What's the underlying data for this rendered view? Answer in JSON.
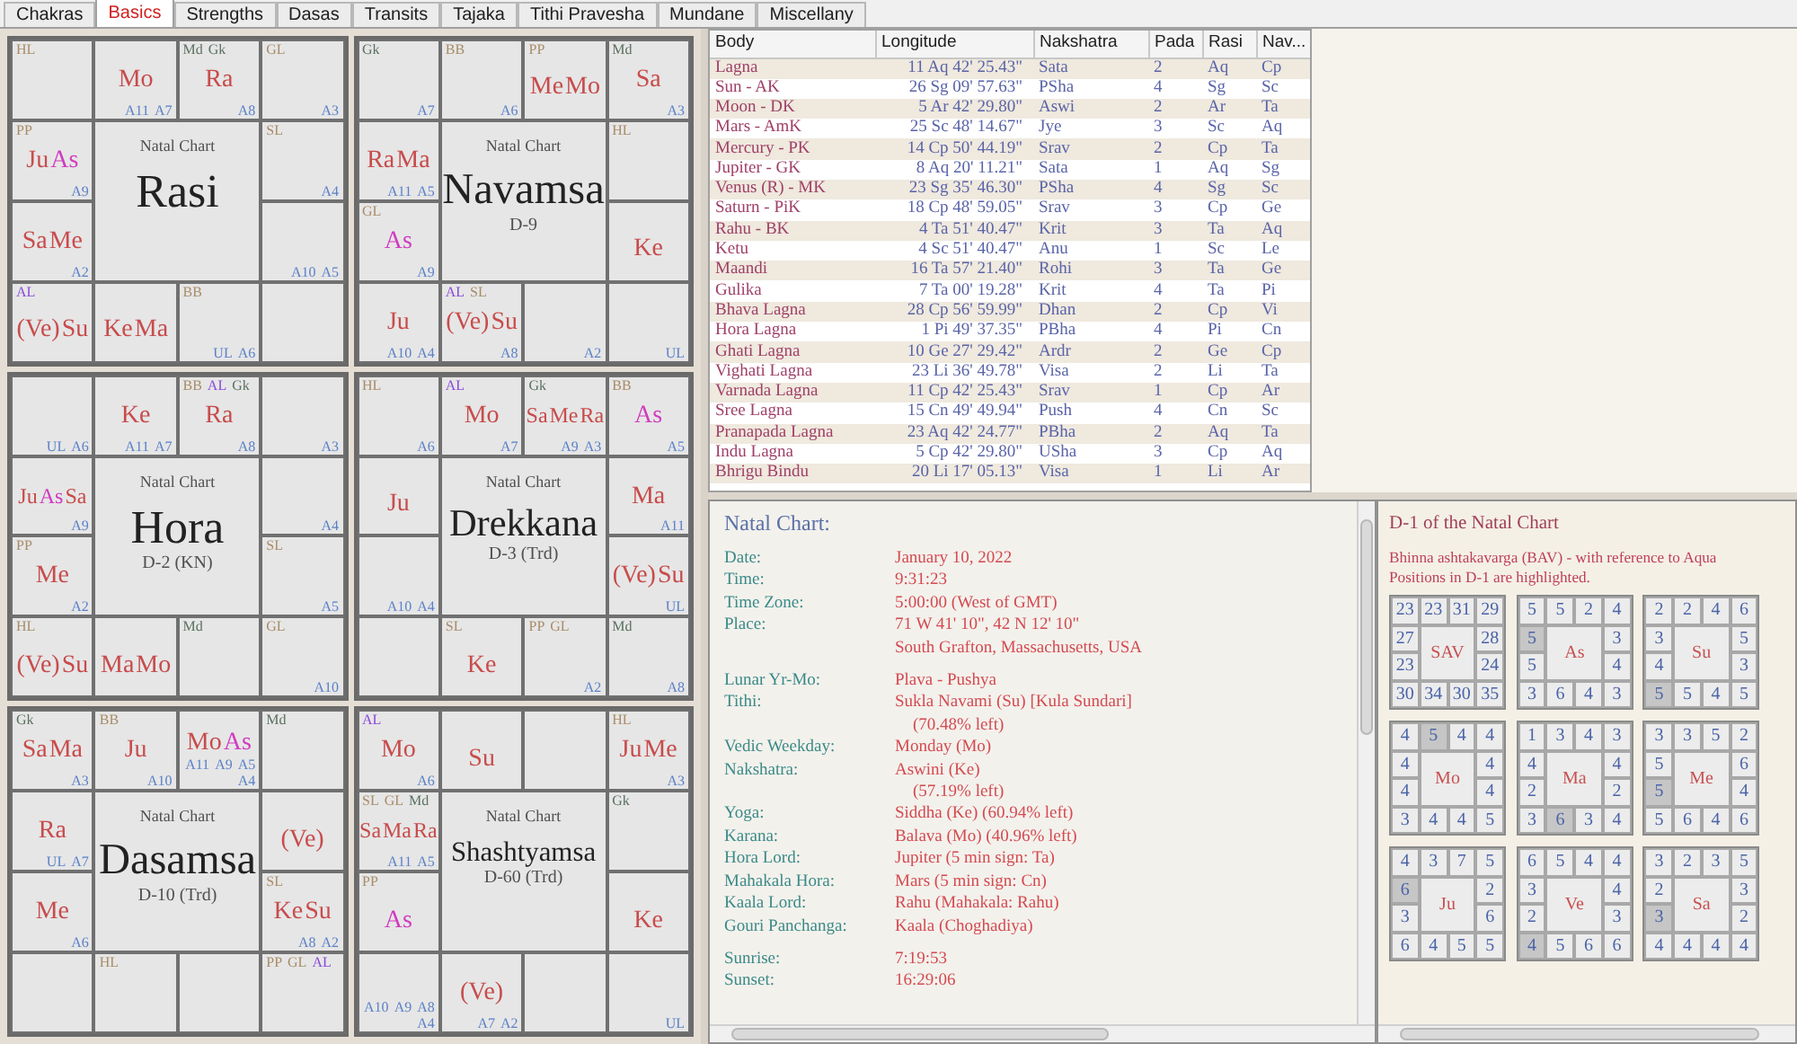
{
  "tabs": [
    {
      "label": "Chakras",
      "selected": false
    },
    {
      "label": "Basics",
      "selected": true
    },
    {
      "label": "Strengths",
      "selected": false
    },
    {
      "label": "Dasas",
      "selected": false
    },
    {
      "label": "Transits",
      "selected": false
    },
    {
      "label": "Tajaka",
      "selected": false
    },
    {
      "label": "Tithi Pravesha",
      "selected": false
    },
    {
      "label": "Mundane",
      "selected": false
    },
    {
      "label": "Miscellany",
      "selected": false
    }
  ],
  "charts": [
    {
      "caption": "Natal Chart",
      "title": "Rasi",
      "cells": [
        {
          "markers": [
            {
              "text": "HL",
              "kind": "special"
            }
          ]
        },
        {
          "planets": [
            {
              "text": "Mo",
              "kind": "planet"
            }
          ],
          "arudhas": [
            "A11",
            "A7"
          ]
        },
        {
          "markers": [
            {
              "text": "Md",
              "kind": "upagraha"
            },
            {
              "text": "Gk",
              "kind": "upagraha"
            }
          ],
          "planets": [
            {
              "text": "Ra",
              "kind": "planet"
            }
          ],
          "arudhas": [
            "A8"
          ]
        },
        {
          "markers": [
            {
              "text": "GL",
              "kind": "special"
            }
          ],
          "arudhas": [
            "A3"
          ]
        },
        {
          "markers": [
            {
              "text": "PP",
              "kind": "special"
            }
          ],
          "planets": [
            {
              "text": "Ju",
              "kind": "planet"
            },
            {
              "text": "As",
              "kind": "lagna"
            }
          ],
          "arudhas": [
            "A9"
          ]
        },
        {
          "markers": [
            {
              "text": "SL",
              "kind": "special"
            }
          ],
          "arudhas": [
            "A4"
          ]
        },
        {
          "planets": [
            {
              "text": "Sa",
              "kind": "planet"
            },
            {
              "text": "Me",
              "kind": "planet"
            }
          ],
          "arudhas": [
            "A2"
          ]
        },
        {
          "arudhas": [
            "A10",
            "A5"
          ]
        },
        {
          "markers": [
            {
              "text": "AL",
              "kind": "arudha_lagna"
            }
          ],
          "planets": [
            {
              "text": "(Ve)",
              "kind": "planet"
            },
            {
              "text": "Su",
              "kind": "planet"
            }
          ]
        },
        {
          "planets": [
            {
              "text": "Ke",
              "kind": "planet"
            },
            {
              "text": "Ma",
              "kind": "planet"
            }
          ]
        },
        {
          "markers": [
            {
              "text": "BB",
              "kind": "special"
            }
          ],
          "arudhas": [
            "UL",
            "A6"
          ]
        },
        {}
      ]
    },
    {
      "caption": "Natal Chart",
      "title": "Navamsa",
      "subtitle": "D-9",
      "cells": [
        {
          "markers": [
            {
              "text": "Gk",
              "kind": "upagraha"
            }
          ],
          "arudhas": [
            "A7"
          ]
        },
        {
          "markers": [
            {
              "text": "BB",
              "kind": "special"
            }
          ],
          "arudhas": [
            "A6"
          ]
        },
        {
          "markers": [
            {
              "text": "PP",
              "kind": "special"
            }
          ],
          "planets": [
            {
              "text": "Me",
              "kind": "planet"
            },
            {
              "text": "Mo",
              "kind": "planet"
            }
          ]
        },
        {
          "markers": [
            {
              "text": "Md",
              "kind": "upagraha"
            }
          ],
          "planets": [
            {
              "text": "Sa",
              "kind": "planet"
            }
          ],
          "arudhas": [
            "A3"
          ]
        },
        {
          "planets": [
            {
              "text": "Ra",
              "kind": "planet"
            },
            {
              "text": "Ma",
              "kind": "planet"
            }
          ],
          "arudhas": [
            "A11",
            "A5"
          ]
        },
        {
          "markers": [
            {
              "text": "HL",
              "kind": "special"
            }
          ]
        },
        {
          "markers": [
            {
              "text": "GL",
              "kind": "special"
            }
          ],
          "planets": [
            {
              "text": "As",
              "kind": "lagna"
            }
          ],
          "arudhas": [
            "A9"
          ]
        },
        {
          "planets": [
            {
              "text": "Ke",
              "kind": "planet"
            }
          ]
        },
        {
          "planets": [
            {
              "text": "Ju",
              "kind": "planet"
            }
          ],
          "arudhas": [
            "A10",
            "A4"
          ]
        },
        {
          "markers": [
            {
              "text": "AL",
              "kind": "arudha_lagna"
            },
            {
              "text": "SL",
              "kind": "special"
            }
          ],
          "planets": [
            {
              "text": "(Ve)",
              "kind": "planet"
            },
            {
              "text": "Su",
              "kind": "planet"
            }
          ],
          "arudhas": [
            "A8"
          ]
        },
        {
          "arudhas": [
            "A2"
          ]
        },
        {
          "arudhas": [
            "UL"
          ]
        }
      ]
    },
    {
      "caption": "Natal Chart",
      "title": "Hora",
      "subtitle": "D-2 (KN)",
      "cells": [
        {
          "arudhas": [
            "UL",
            "A6"
          ]
        },
        {
          "planets": [
            {
              "text": "Ke",
              "kind": "planet"
            }
          ],
          "arudhas": [
            "A11",
            "A7"
          ]
        },
        {
          "markers": [
            {
              "text": "BB",
              "kind": "special"
            },
            {
              "text": "AL",
              "kind": "arudha_lagna"
            },
            {
              "text": "Gk",
              "kind": "upagraha"
            }
          ],
          "planets": [
            {
              "text": "Ra",
              "kind": "planet"
            }
          ],
          "arudhas": [
            "A8"
          ]
        },
        {
          "arudhas": [
            "A3"
          ]
        },
        {
          "planets": [
            {
              "text": "Ju",
              "kind": "planet"
            },
            {
              "text": "As",
              "kind": "lagna"
            },
            {
              "text": "Sa",
              "kind": "planet"
            }
          ],
          "arudhas": [
            "A9"
          ]
        },
        {
          "arudhas": [
            "A4"
          ]
        },
        {
          "markers": [
            {
              "text": "PP",
              "kind": "special"
            }
          ],
          "planets": [
            {
              "text": "Me",
              "kind": "planet"
            }
          ],
          "arudhas": [
            "A2"
          ]
        },
        {
          "markers": [
            {
              "text": "SL",
              "kind": "special"
            }
          ],
          "arudhas": [
            "A5"
          ]
        },
        {
          "markers": [
            {
              "text": "HL",
              "kind": "special"
            }
          ],
          "planets": [
            {
              "text": "(Ve)",
              "kind": "planet"
            },
            {
              "text": "Su",
              "kind": "planet"
            }
          ]
        },
        {
          "planets": [
            {
              "text": "Ma",
              "kind": "planet"
            },
            {
              "text": "Mo",
              "kind": "planet"
            }
          ]
        },
        {
          "markers": [
            {
              "text": "Md",
              "kind": "upagraha"
            }
          ]
        },
        {
          "markers": [
            {
              "text": "GL",
              "kind": "special"
            }
          ],
          "arudhas": [
            "A10"
          ]
        }
      ]
    },
    {
      "caption": "Natal Chart",
      "title": "Drekkana",
      "subtitle": "D-3 (Trd)",
      "cells": [
        {
          "markers": [
            {
              "text": "HL",
              "kind": "special"
            }
          ],
          "arudhas": [
            "A6"
          ]
        },
        {
          "markers": [
            {
              "text": "AL",
              "kind": "arudha_lagna"
            }
          ],
          "planets": [
            {
              "text": "Mo",
              "kind": "planet"
            }
          ],
          "arudhas": [
            "A7"
          ]
        },
        {
          "markers": [
            {
              "text": "Gk",
              "kind": "upagraha"
            }
          ],
          "planets": [
            {
              "text": "Sa",
              "kind": "planet"
            },
            {
              "text": "Me",
              "kind": "planet"
            },
            {
              "text": "Ra",
              "kind": "planet"
            }
          ],
          "arudhas": [
            "A9",
            "A3"
          ]
        },
        {
          "markers": [
            {
              "text": "BB",
              "kind": "special"
            }
          ],
          "planets": [
            {
              "text": "As",
              "kind": "lagna"
            }
          ],
          "arudhas": [
            "A5"
          ]
        },
        {
          "planets": [
            {
              "text": "Ju",
              "kind": "planet"
            }
          ]
        },
        {
          "planets": [
            {
              "text": "Ma",
              "kind": "planet"
            }
          ],
          "arudhas": [
            "A11"
          ]
        },
        {
          "arudhas": [
            "A10",
            "A4"
          ]
        },
        {
          "planets": [
            {
              "text": "(Ve)",
              "kind": "planet"
            },
            {
              "text": "Su",
              "kind": "planet"
            }
          ],
          "arudhas": [
            "UL"
          ]
        },
        {},
        {
          "markers": [
            {
              "text": "SL",
              "kind": "special"
            }
          ],
          "planets": [
            {
              "text": "Ke",
              "kind": "planet"
            }
          ]
        },
        {
          "markers": [
            {
              "text": "PP",
              "kind": "special"
            },
            {
              "text": "GL",
              "kind": "special"
            }
          ],
          "arudhas": [
            "A2"
          ]
        },
        {
          "markers": [
            {
              "text": "Md",
              "kind": "upagraha"
            }
          ],
          "arudhas": [
            "A8"
          ]
        }
      ]
    },
    {
      "caption": "Natal Chart",
      "title": "Dasamsa",
      "subtitle": "D-10 (Trd)",
      "cells": [
        {
          "markers": [
            {
              "text": "Gk",
              "kind": "upagraha"
            }
          ],
          "planets": [
            {
              "text": "Sa",
              "kind": "planet"
            },
            {
              "text": "Ma",
              "kind": "planet"
            }
          ],
          "arudhas": [
            "A3"
          ]
        },
        {
          "markers": [
            {
              "text": "BB",
              "kind": "special"
            }
          ],
          "planets": [
            {
              "text": "Ju",
              "kind": "planet"
            }
          ],
          "arudhas": [
            "A10"
          ]
        },
        {
          "planets": [
            {
              "text": "Mo",
              "kind": "planet"
            },
            {
              "text": "As",
              "kind": "lagna"
            }
          ],
          "arudhas": [
            "A11",
            "A9",
            "A5",
            "A4"
          ]
        },
        {
          "markers": [
            {
              "text": "Md",
              "kind": "upagraha"
            }
          ]
        },
        {
          "planets": [
            {
              "text": "Ra",
              "kind": "planet"
            }
          ],
          "arudhas": [
            "UL",
            "A7"
          ]
        },
        {
          "planets": [
            {
              "text": "(Ve)",
              "kind": "planet"
            }
          ]
        },
        {
          "planets": [
            {
              "text": "Me",
              "kind": "planet"
            }
          ],
          "arudhas": [
            "A6"
          ]
        },
        {
          "markers": [
            {
              "text": "SL",
              "kind": "special"
            }
          ],
          "planets": [
            {
              "text": "Ke",
              "kind": "planet"
            },
            {
              "text": "Su",
              "kind": "planet"
            }
          ],
          "arudhas": [
            "A8",
            "A2"
          ]
        },
        {},
        {
          "markers": [
            {
              "text": "HL",
              "kind": "special"
            }
          ]
        },
        {},
        {
          "markers": [
            {
              "text": "PP",
              "kind": "special"
            },
            {
              "text": "GL",
              "kind": "special"
            },
            {
              "text": "AL",
              "kind": "arudha_lagna"
            }
          ]
        }
      ]
    },
    {
      "caption": "Natal Chart",
      "title": "Shashtyamsa",
      "subtitle": "D-60 (Trd)",
      "cells": [
        {
          "markers": [
            {
              "text": "AL",
              "kind": "arudha_lagna"
            }
          ],
          "planets": [
            {
              "text": "Mo",
              "kind": "planet"
            }
          ],
          "arudhas": [
            "A6"
          ]
        },
        {
          "planets": [
            {
              "text": "Su",
              "kind": "planet"
            }
          ]
        },
        {},
        {
          "markers": [
            {
              "text": "HL",
              "kind": "special"
            }
          ],
          "planets": [
            {
              "text": "Ju",
              "kind": "planet"
            },
            {
              "text": "Me",
              "kind": "planet"
            }
          ],
          "arudhas": [
            "A3"
          ]
        },
        {
          "markers": [
            {
              "text": "SL",
              "kind": "special"
            },
            {
              "text": "GL",
              "kind": "special"
            },
            {
              "text": "Md",
              "kind": "upagraha"
            }
          ],
          "planets": [
            {
              "text": "Sa",
              "kind": "planet"
            },
            {
              "text": "Ma",
              "kind": "planet"
            },
            {
              "text": "Ra",
              "kind": "planet"
            }
          ],
          "arudhas": [
            "A11",
            "A5"
          ]
        },
        {
          "markers": [
            {
              "text": "Gk",
              "kind": "upagraha"
            }
          ]
        },
        {
          "markers": [
            {
              "text": "PP",
              "kind": "special"
            }
          ],
          "planets": [
            {
              "text": "As",
              "kind": "lagna"
            }
          ]
        },
        {
          "planets": [
            {
              "text": "Ke",
              "kind": "planet"
            }
          ]
        },
        {
          "arudhas": [
            "A10",
            "A9",
            "A8",
            "A4"
          ]
        },
        {
          "planets": [
            {
              "text": "(Ve)",
              "kind": "planet"
            }
          ],
          "arudhas": [
            "A7",
            "A2"
          ]
        },
        {},
        {
          "arudhas": [
            "UL"
          ]
        }
      ]
    }
  ],
  "table": {
    "columns": [
      "Body",
      "Longitude",
      "Nakshatra",
      "Pada",
      "Rasi",
      "Nav..."
    ],
    "rows": [
      [
        "Lagna",
        "11 Aq 42' 25.43\"",
        "Sata",
        "2",
        "Aq",
        "Cp"
      ],
      [
        "Sun - AK",
        "26 Sg 09' 57.63\"",
        "PSha",
        "4",
        "Sg",
        "Sc"
      ],
      [
        "Moon - DK",
        "5 Ar 42' 29.80\"",
        "Aswi",
        "2",
        "Ar",
        "Ta"
      ],
      [
        "Mars - AmK",
        "25 Sc 48' 14.67\"",
        "Jye",
        "3",
        "Sc",
        "Aq"
      ],
      [
        "Mercury - PK",
        "14 Cp 50' 44.19\"",
        "Srav",
        "2",
        "Cp",
        "Ta"
      ],
      [
        "Jupiter - GK",
        "8 Aq 20' 11.21\"",
        "Sata",
        "1",
        "Aq",
        "Sg"
      ],
      [
        "Venus (R) - MK",
        "23 Sg 35' 46.30\"",
        "PSha",
        "4",
        "Sg",
        "Sc"
      ],
      [
        "Saturn - PiK",
        "18 Cp 48' 59.05\"",
        "Srav",
        "3",
        "Cp",
        "Ge"
      ],
      [
        "Rahu - BK",
        "4 Ta 51' 40.47\"",
        "Krit",
        "3",
        "Ta",
        "Aq"
      ],
      [
        "Ketu",
        "4 Sc 51' 40.47\"",
        "Anu",
        "1",
        "Sc",
        "Le"
      ],
      [
        "Maandi",
        "16 Ta 57' 21.40\"",
        "Rohi",
        "3",
        "Ta",
        "Ge"
      ],
      [
        "Gulika",
        "7 Ta 00' 19.28\"",
        "Krit",
        "4",
        "Ta",
        "Pi"
      ],
      [
        "Bhava Lagna",
        "28 Cp 56' 59.99\"",
        "Dhan",
        "2",
        "Cp",
        "Vi"
      ],
      [
        "Hora Lagna",
        "1 Pi 49' 37.35\"",
        "PBha",
        "4",
        "Pi",
        "Cn"
      ],
      [
        "Ghati Lagna",
        "10 Ge 27' 29.42\"",
        "Ardr",
        "2",
        "Ge",
        "Cp"
      ],
      [
        "Vighati Lagna",
        "23 Li 36' 49.78\"",
        "Visa",
        "2",
        "Li",
        "Ta"
      ],
      [
        "Varnada Lagna",
        "11 Cp 42' 25.43\"",
        "Srav",
        "1",
        "Cp",
        "Ar"
      ],
      [
        "Sree Lagna",
        "15 Cn 49' 49.94\"",
        "Push",
        "4",
        "Cn",
        "Sc"
      ],
      [
        "Pranapada Lagna",
        "23 Aq 42' 24.77\"",
        "PBha",
        "2",
        "Aq",
        "Ta"
      ],
      [
        "Indu Lagna",
        "5 Cp 42' 29.80\"",
        "USha",
        "3",
        "Cp",
        "Aq"
      ],
      [
        "Bhrigu Bindu",
        "20 Li 17' 05.13\"",
        "Visa",
        "1",
        "Li",
        "Ar"
      ]
    ]
  },
  "natal_info": {
    "heading": "Natal Chart:",
    "groups": [
      [
        {
          "kind": "field",
          "label": "Date:",
          "value": "January 10, 2022"
        },
        {
          "kind": "field",
          "label": "Time:",
          "value": "9:31:23"
        },
        {
          "kind": "field",
          "label": "Time Zone:",
          "value": "5:00:00 (West of GMT)"
        },
        {
          "kind": "field",
          "label": "Place:",
          "value": "71 W 41' 10\", 42 N 12' 10\""
        },
        {
          "kind": "line",
          "value": "South Grafton, Massachusetts, USA"
        }
      ],
      [
        {
          "kind": "field",
          "label": "Lunar Yr-Mo:",
          "value": "Plava - Pushya"
        },
        {
          "kind": "field",
          "label": "Tithi:",
          "value": "Sukla Navami (Su) [Kula Sundari]"
        },
        {
          "kind": "note",
          "value": "(70.48% left)"
        },
        {
          "kind": "field",
          "label": "Vedic Weekday:",
          "value": "Monday (Mo)"
        },
        {
          "kind": "field",
          "label": "Nakshatra:",
          "value": "Aswini (Ke)"
        },
        {
          "kind": "note",
          "value": "(57.19% left)"
        },
        {
          "kind": "field",
          "label": "Yoga:",
          "value": "Siddha (Ke) (60.94% left)"
        },
        {
          "kind": "field",
          "label": "Karana:",
          "value": "Balava (Mo) (40.96% left)"
        },
        {
          "kind": "field",
          "label": "Hora Lord:",
          "value": "Jupiter (5 min sign: Ta)"
        },
        {
          "kind": "field",
          "label": "Mahakala Hora:",
          "value": "Mars (5 min sign: Cn)"
        },
        {
          "kind": "field",
          "label": "Kaala Lord:",
          "value": "Rahu (Mahakala: Rahu)"
        },
        {
          "kind": "field",
          "label": "Gouri Panchanga:",
          "value": "Kaala (Choghadiya)"
        }
      ],
      [
        {
          "kind": "field",
          "label": "Sunrise:",
          "value": "7:19:53"
        },
        {
          "kind": "field",
          "label": "Sunset:",
          "value": "16:29:06"
        }
      ]
    ]
  },
  "bav": {
    "heading": "D-1 of the Natal Chart",
    "description": [
      "Bhinna ashtakavarga (BAV) - with reference to Aqua",
      "Positions in D-1 are highlighted."
    ],
    "grids": [
      {
        "name": "SAV",
        "cells": [
          {
            "value": "23",
            "highlighted": false
          },
          {
            "value": "23",
            "highlighted": false
          },
          {
            "value": "31",
            "highlighted": false
          },
          {
            "value": "29",
            "highlighted": false
          },
          {
            "value": "27",
            "highlighted": false
          },
          {
            "value": "28",
            "highlighted": false
          },
          {
            "value": "23",
            "highlighted": false
          },
          {
            "value": "24",
            "highlighted": false
          },
          {
            "value": "30",
            "highlighted": false
          },
          {
            "value": "34",
            "highlighted": false
          },
          {
            "value": "30",
            "highlighted": false
          },
          {
            "value": "35",
            "highlighted": false
          }
        ]
      },
      {
        "name": "As",
        "cells": [
          {
            "value": "5",
            "highlighted": false
          },
          {
            "value": "5",
            "highlighted": false
          },
          {
            "value": "2",
            "highlighted": false
          },
          {
            "value": "4",
            "highlighted": false
          },
          {
            "value": "5",
            "highlighted": true
          },
          {
            "value": "3",
            "highlighted": false
          },
          {
            "value": "5",
            "highlighted": false
          },
          {
            "value": "4",
            "highlighted": false
          },
          {
            "value": "3",
            "highlighted": false
          },
          {
            "value": "6",
            "highlighted": false
          },
          {
            "value": "4",
            "highlighted": false
          },
          {
            "value": "3",
            "highlighted": false
          }
        ]
      },
      {
        "name": "Su",
        "cells": [
          {
            "value": "2",
            "highlighted": false
          },
          {
            "value": "2",
            "highlighted": false
          },
          {
            "value": "4",
            "highlighted": false
          },
          {
            "value": "6",
            "highlighted": false
          },
          {
            "value": "3",
            "highlighted": false
          },
          {
            "value": "5",
            "highlighted": false
          },
          {
            "value": "4",
            "highlighted": false
          },
          {
            "value": "3",
            "highlighted": false
          },
          {
            "value": "5",
            "highlighted": true
          },
          {
            "value": "5",
            "highlighted": false
          },
          {
            "value": "4",
            "highlighted": false
          },
          {
            "value": "5",
            "highlighted": false
          }
        ]
      },
      {
        "name": "Mo",
        "cells": [
          {
            "value": "4",
            "highlighted": false
          },
          {
            "value": "5",
            "highlighted": true
          },
          {
            "value": "4",
            "highlighted": false
          },
          {
            "value": "4",
            "highlighted": false
          },
          {
            "value": "4",
            "highlighted": false
          },
          {
            "value": "4",
            "highlighted": false
          },
          {
            "value": "4",
            "highlighted": false
          },
          {
            "value": "4",
            "highlighted": false
          },
          {
            "value": "3",
            "highlighted": false
          },
          {
            "value": "4",
            "highlighted": false
          },
          {
            "value": "4",
            "highlighted": false
          },
          {
            "value": "5",
            "highlighted": false
          }
        ]
      },
      {
        "name": "Ma",
        "cells": [
          {
            "value": "1",
            "highlighted": false
          },
          {
            "value": "3",
            "highlighted": false
          },
          {
            "value": "4",
            "highlighted": false
          },
          {
            "value": "3",
            "highlighted": false
          },
          {
            "value": "4",
            "highlighted": false
          },
          {
            "value": "4",
            "highlighted": false
          },
          {
            "value": "2",
            "highlighted": false
          },
          {
            "value": "2",
            "highlighted": false
          },
          {
            "value": "3",
            "highlighted": false
          },
          {
            "value": "6",
            "highlighted": true
          },
          {
            "value": "3",
            "highlighted": false
          },
          {
            "value": "4",
            "highlighted": false
          }
        ]
      },
      {
        "name": "Me",
        "cells": [
          {
            "value": "3",
            "highlighted": false
          },
          {
            "value": "3",
            "highlighted": false
          },
          {
            "value": "5",
            "highlighted": false
          },
          {
            "value": "2",
            "highlighted": false
          },
          {
            "value": "5",
            "highlighted": false
          },
          {
            "value": "6",
            "highlighted": false
          },
          {
            "value": "5",
            "highlighted": true
          },
          {
            "value": "4",
            "highlighted": false
          },
          {
            "value": "5",
            "highlighted": false
          },
          {
            "value": "6",
            "highlighted": false
          },
          {
            "value": "4",
            "highlighted": false
          },
          {
            "value": "6",
            "highlighted": false
          }
        ]
      },
      {
        "name": "Ju",
        "cells": [
          {
            "value": "4",
            "highlighted": false
          },
          {
            "value": "3",
            "highlighted": false
          },
          {
            "value": "7",
            "highlighted": false
          },
          {
            "value": "5",
            "highlighted": false
          },
          {
            "value": "6",
            "highlighted": true
          },
          {
            "value": "2",
            "highlighted": false
          },
          {
            "value": "3",
            "highlighted": false
          },
          {
            "value": "6",
            "highlighted": false
          },
          {
            "value": "6",
            "highlighted": false
          },
          {
            "value": "4",
            "highlighted": false
          },
          {
            "value": "5",
            "highlighted": false
          },
          {
            "value": "5",
            "highlighted": false
          }
        ]
      },
      {
        "name": "Ve",
        "cells": [
          {
            "value": "6",
            "highlighted": false
          },
          {
            "value": "5",
            "highlighted": false
          },
          {
            "value": "4",
            "highlighted": false
          },
          {
            "value": "4",
            "highlighted": false
          },
          {
            "value": "3",
            "highlighted": false
          },
          {
            "value": "4",
            "highlighted": false
          },
          {
            "value": "2",
            "highlighted": false
          },
          {
            "value": "3",
            "highlighted": false
          },
          {
            "value": "4",
            "highlighted": true
          },
          {
            "value": "5",
            "highlighted": false
          },
          {
            "value": "6",
            "highlighted": false
          },
          {
            "value": "6",
            "highlighted": false
          }
        ]
      },
      {
        "name": "Sa",
        "cells": [
          {
            "value": "3",
            "highlighted": false
          },
          {
            "value": "2",
            "highlighted": false
          },
          {
            "value": "3",
            "highlighted": false
          },
          {
            "value": "5",
            "highlighted": false
          },
          {
            "value": "2",
            "highlighted": false
          },
          {
            "value": "3",
            "highlighted": false
          },
          {
            "value": "3",
            "highlighted": true
          },
          {
            "value": "2",
            "highlighted": false
          },
          {
            "value": "4",
            "highlighted": false
          },
          {
            "value": "4",
            "highlighted": false
          },
          {
            "value": "4",
            "highlighted": false
          },
          {
            "value": "4",
            "highlighted": false
          }
        ]
      }
    ]
  }
}
